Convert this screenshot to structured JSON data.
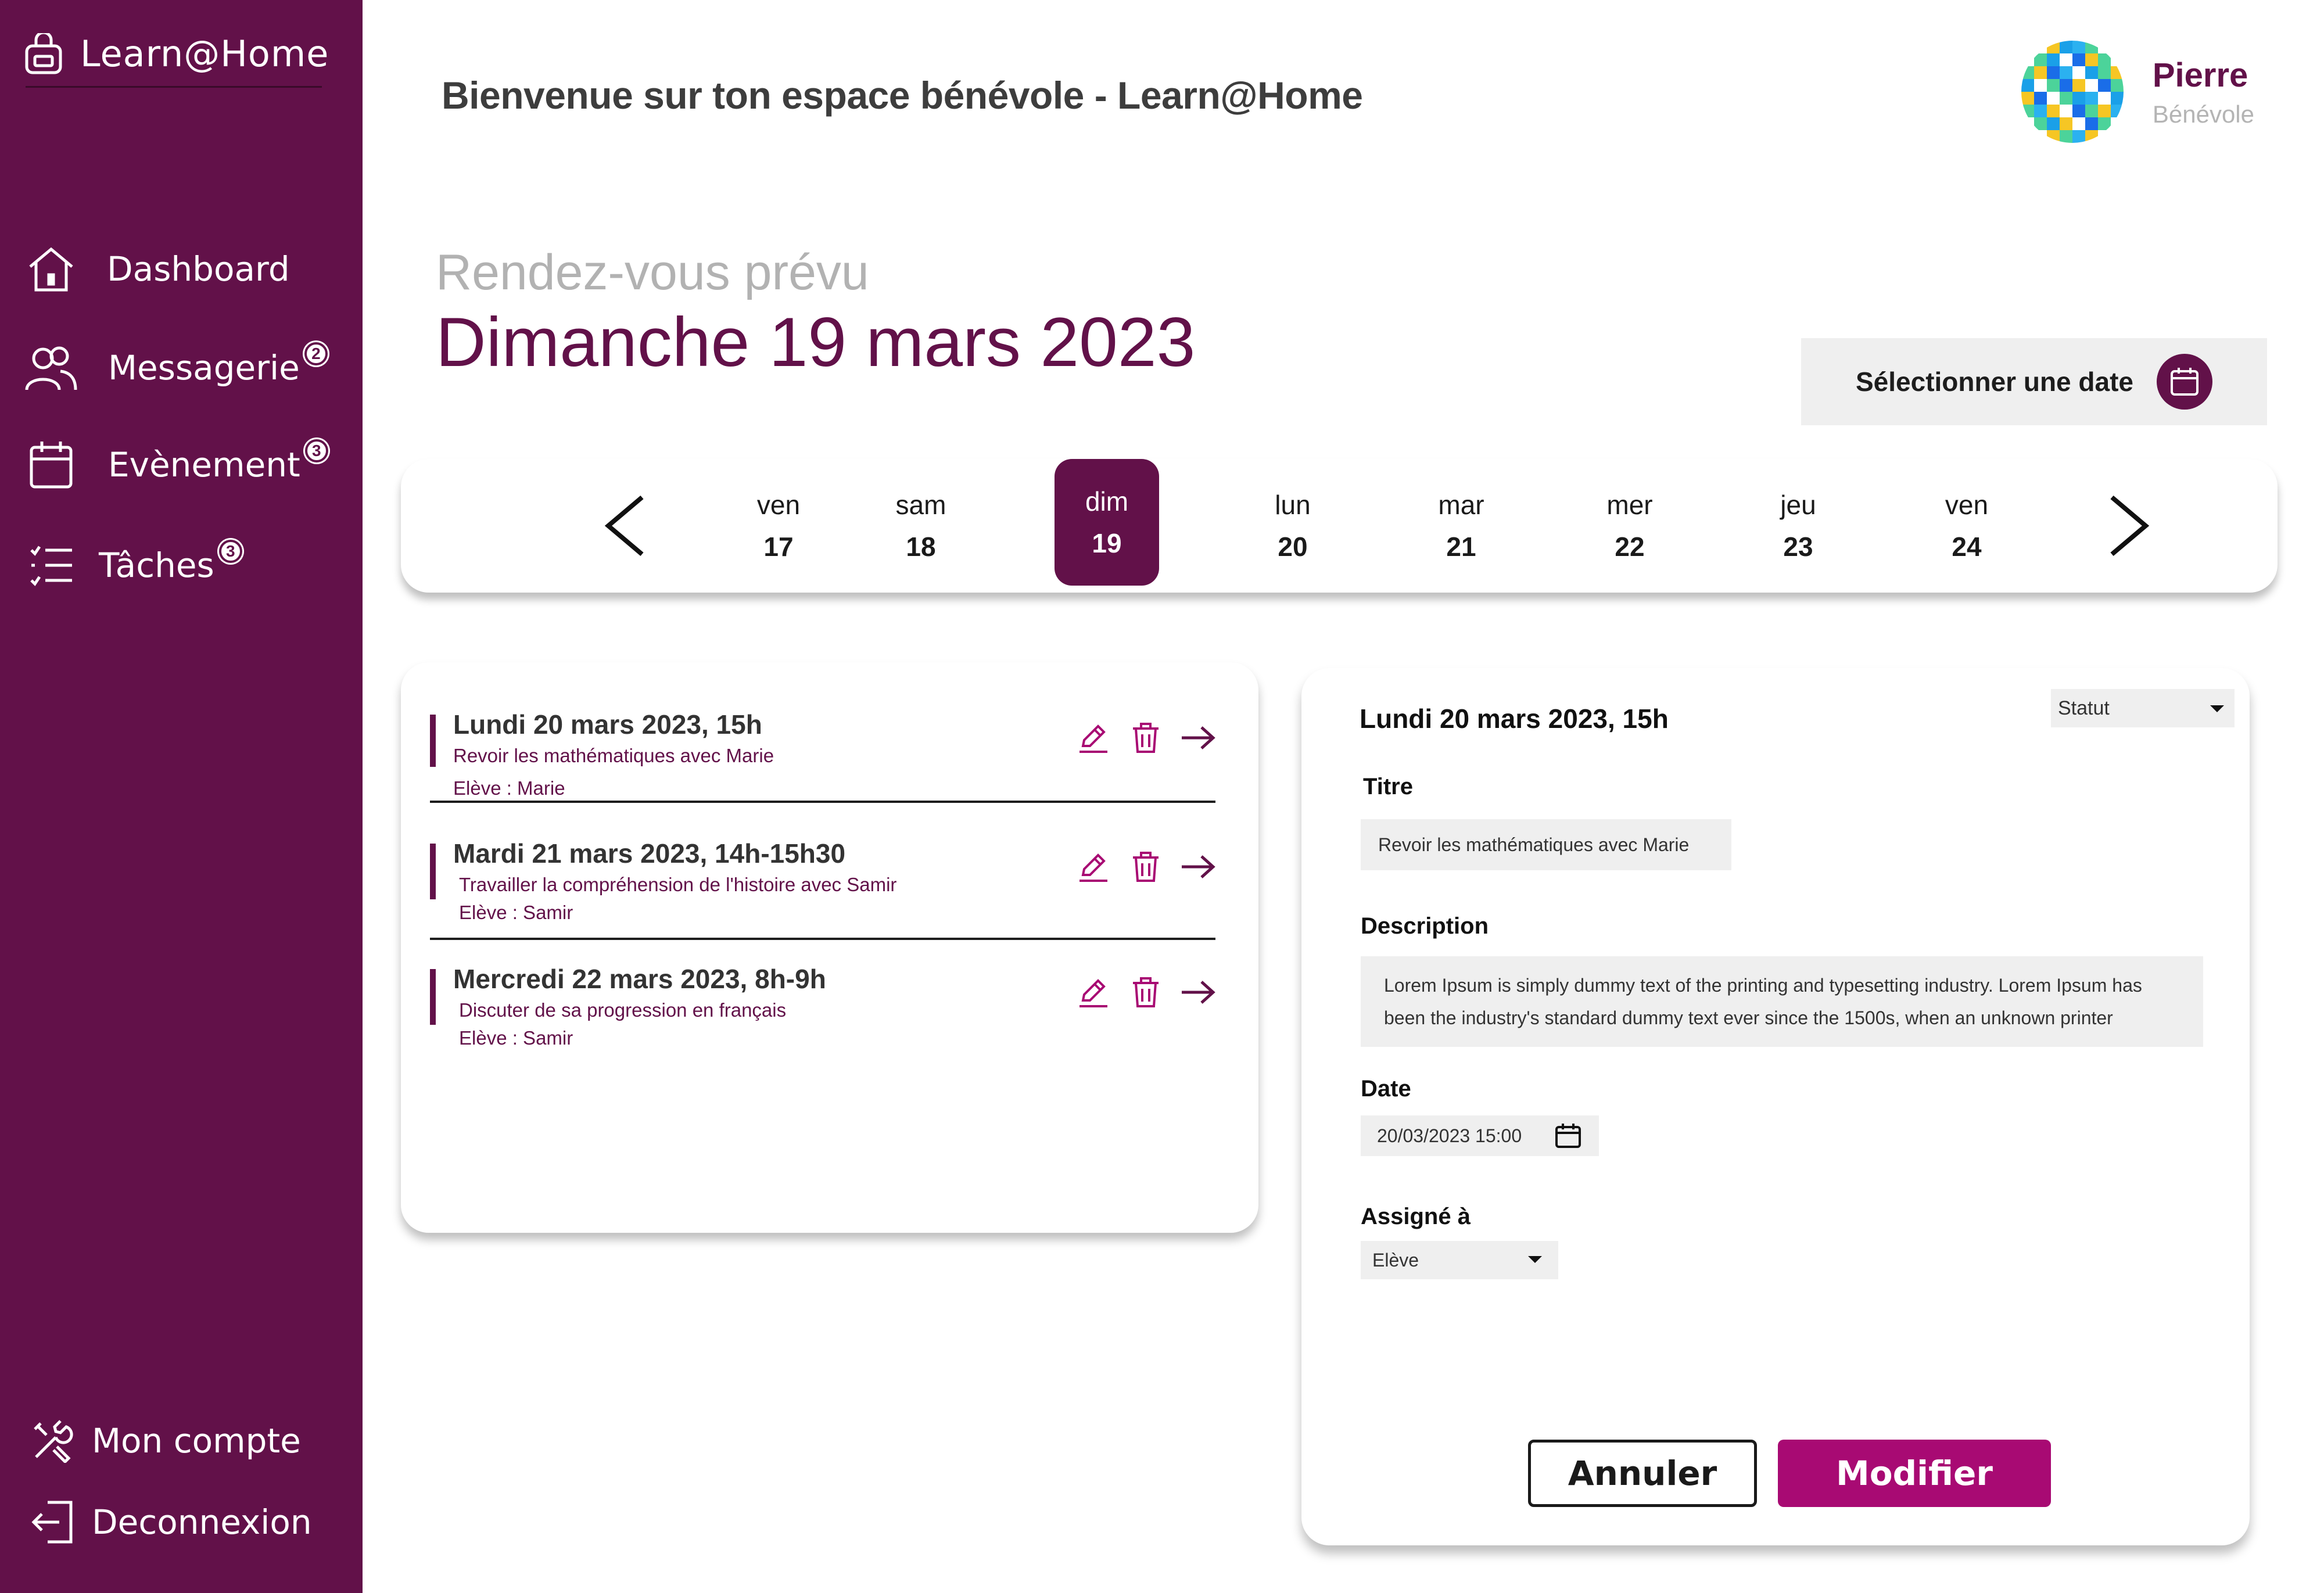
{
  "app": {
    "name": "Learn@Home"
  },
  "sidebar": {
    "items": [
      {
        "label": "Dashboard",
        "icon": "home-icon",
        "badge": ""
      },
      {
        "label": "Messagerie",
        "icon": "users-icon",
        "badge": "2"
      },
      {
        "label": "Evènement",
        "icon": "calendar-icon",
        "badge": "3"
      },
      {
        "label": "Tâches",
        "icon": "list-icon",
        "badge": "3"
      }
    ],
    "bottom": [
      {
        "label": "Mon compte",
        "icon": "tools-icon"
      },
      {
        "label": "Deconnexion",
        "icon": "logout-icon"
      }
    ]
  },
  "header": {
    "welcome": "Bienvenue sur ton espace bénévole - Learn@Home",
    "user_name": "Pierre",
    "user_role": "Bénévole"
  },
  "main": {
    "subtitle": "Rendez-vous prévu",
    "date": "Dimanche 19 mars 2023",
    "select_date_label": "Sélectionner une date"
  },
  "week": {
    "days": [
      {
        "name": "ven",
        "num": "17"
      },
      {
        "name": "sam",
        "num": "18"
      },
      {
        "name": "dim",
        "num": "19"
      },
      {
        "name": "lun",
        "num": "20"
      },
      {
        "name": "mar",
        "num": "21"
      },
      {
        "name": "mer",
        "num": "22"
      },
      {
        "name": "jeu",
        "num": "23"
      },
      {
        "name": "ven",
        "num": "24"
      }
    ],
    "active_index": 2
  },
  "appointments": [
    {
      "title": "Lundi 20 mars 2023, 15h",
      "description": "Revoir les mathématiques avec Marie",
      "student": "Elève : Marie"
    },
    {
      "title": "Mardi 21 mars 2023, 14h-15h30",
      "description": "Travailler la compréhension de l'histoire avec Samir",
      "student": "Elève : Samir"
    },
    {
      "title": "Mercredi 22 mars 2023, 8h-9h",
      "description": "Discuter de sa progression en français",
      "student": "Elève : Samir"
    }
  ],
  "detail": {
    "title": "Lundi 20 mars 2023, 15h",
    "status_placeholder": "Statut",
    "titre_label": "Titre",
    "titre_value": "Revoir les mathématiques avec Marie",
    "description_label": "Description",
    "description_value": "Lorem Ipsum is simply dummy text of the printing and typesetting industry. Lorem Ipsum has been the industry's standard dummy text ever since the 1500s, when an unknown printer",
    "date_label": "Date",
    "date_value": "20/03/2023 15:00",
    "assigned_label": "Assigné à",
    "assigned_value": "Elève",
    "cancel_label": "Annuler",
    "modify_label": "Modifier"
  },
  "colors": {
    "primary": "#621149",
    "accent": "#a80a73",
    "muted": "#efefef"
  }
}
